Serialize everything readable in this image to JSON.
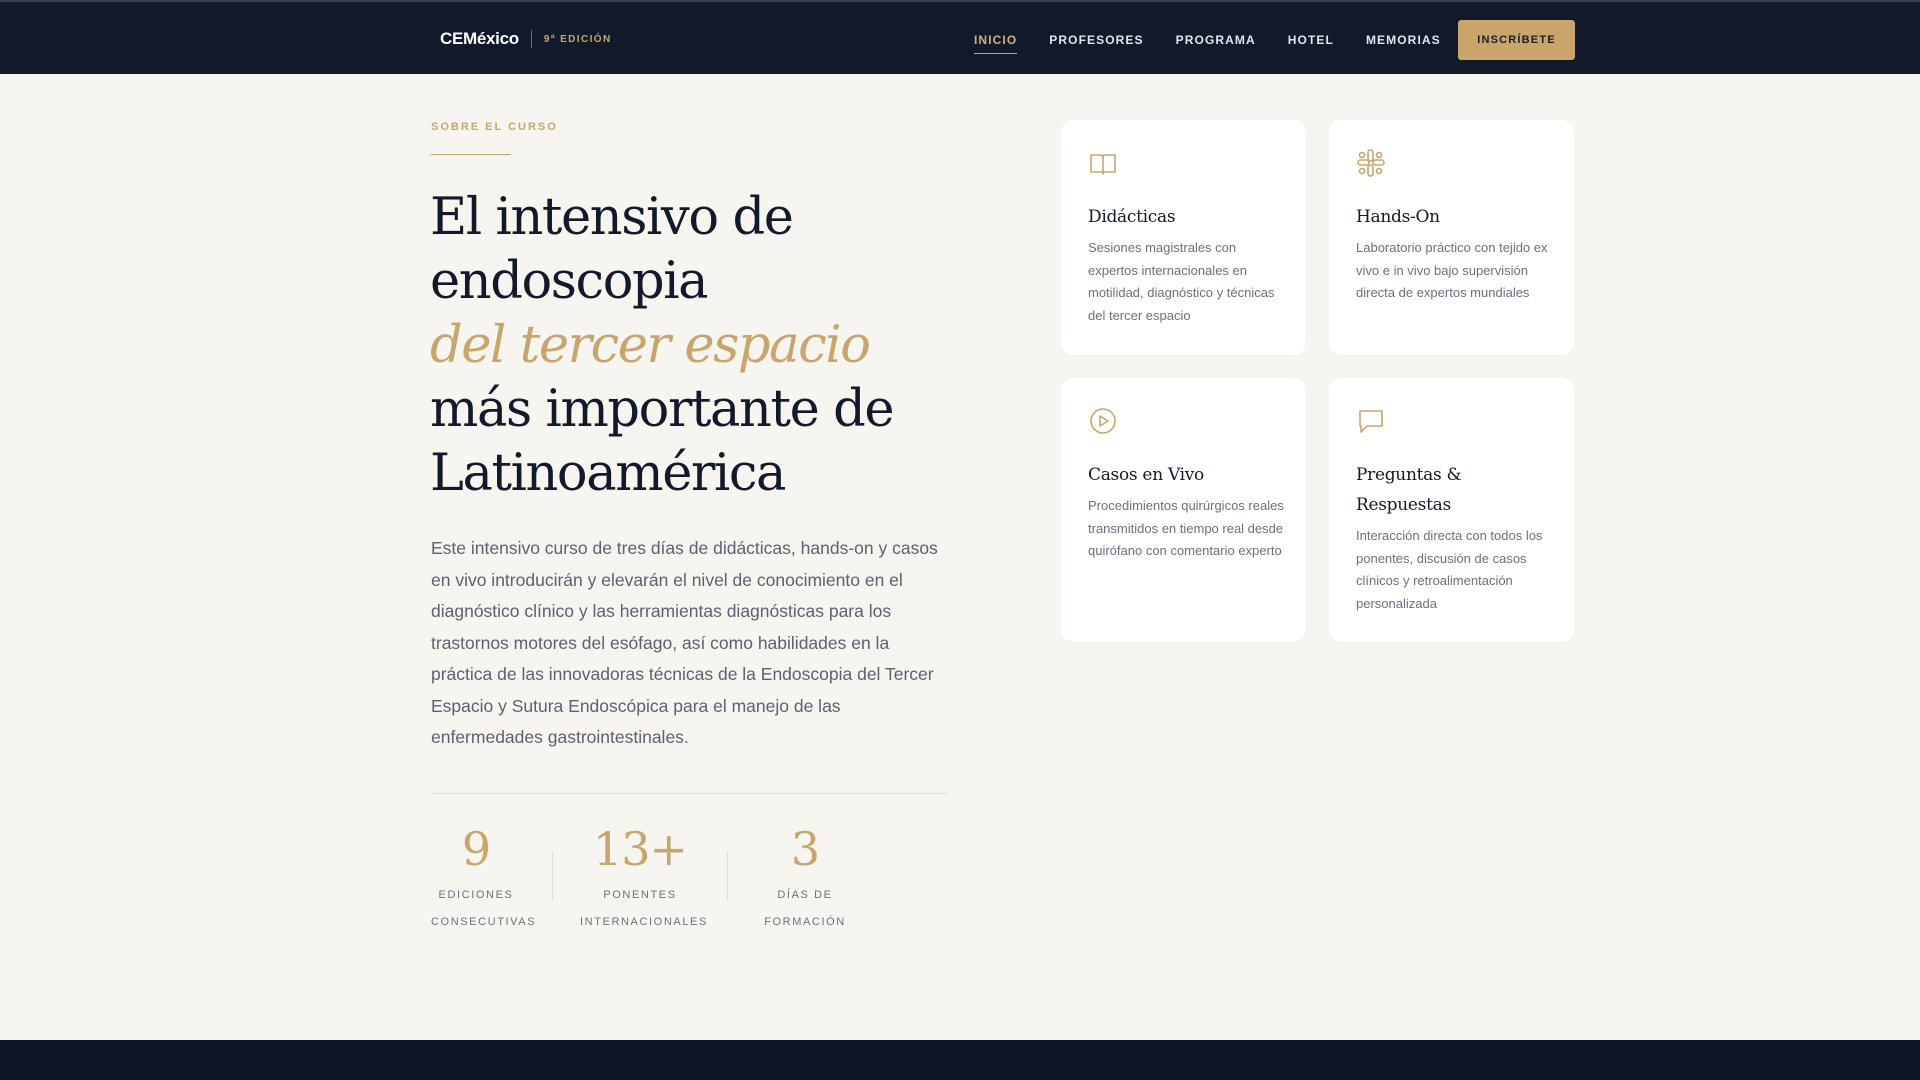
{
  "header": {
    "brand": "CEMéxico",
    "edition": "9ª EDICIÓN",
    "nav": [
      {
        "label": "INICIO",
        "active": true
      },
      {
        "label": "PROFESORES",
        "active": false
      },
      {
        "label": "PROGRAMA",
        "active": false
      },
      {
        "label": "HOTEL",
        "active": false
      },
      {
        "label": "MEMORIAS",
        "active": false
      }
    ],
    "cta_label": "INSCRÍBETE"
  },
  "about": {
    "eyebrow": "SOBRE EL CURSO",
    "headline": {
      "line1": "El intensivo de",
      "line2": "endoscopia",
      "accent": "del tercer espacio",
      "line3": "más importante de",
      "line4": "Latinoamérica"
    },
    "intro": "Este intensivo curso de tres días de didácticas, hands-on y casos en vivo introducirán y elevarán el nivel de conocimiento en el diagnóstico clínico y las herramientas diagnósticas para los trastornos motores del esófago, así como habilidades en la práctica de las innovadoras técnicas de la Endoscopia del Tercer Espacio y Sutura Endoscópica para el manejo de las enfermedades gastrointestinales.",
    "stats": [
      {
        "value": "9",
        "label_line1": "EDICIONES",
        "label_line2": "CONSECUTIVAS"
      },
      {
        "value": "13+",
        "label_line1": "PONENTES",
        "label_line2": "INTERNACIONALES"
      },
      {
        "value": "3",
        "label_line1": "DÍAS DE",
        "label_line2": "FORMACIÓN"
      }
    ]
  },
  "features": [
    {
      "icon": "book-icon",
      "title": "Didácticas",
      "text": "Sesiones magistrales con expertos internacionales en motilidad, diagnóstico y técnicas del tercer espacio"
    },
    {
      "icon": "hands-on-icon",
      "title": "Hands-On",
      "text": "Laboratorio práctico con tejido ex vivo e in vivo bajo supervisión directa de expertos mundiales"
    },
    {
      "icon": "play-circle-icon",
      "title": "Casos en Vivo",
      "text": "Procedimientos quirúrgicos reales transmitidos en tiempo real desde quirófano con comentario experto"
    },
    {
      "icon": "chat-icon",
      "title": "Preguntas & Respuestas",
      "text": "Interacción directa con todos los ponentes, discusión de casos clínicos y retroalimentación personalizada"
    }
  ],
  "colors": {
    "navy": "#111a2b",
    "gold": "#c9a56a",
    "background": "#f7f5f0"
  }
}
